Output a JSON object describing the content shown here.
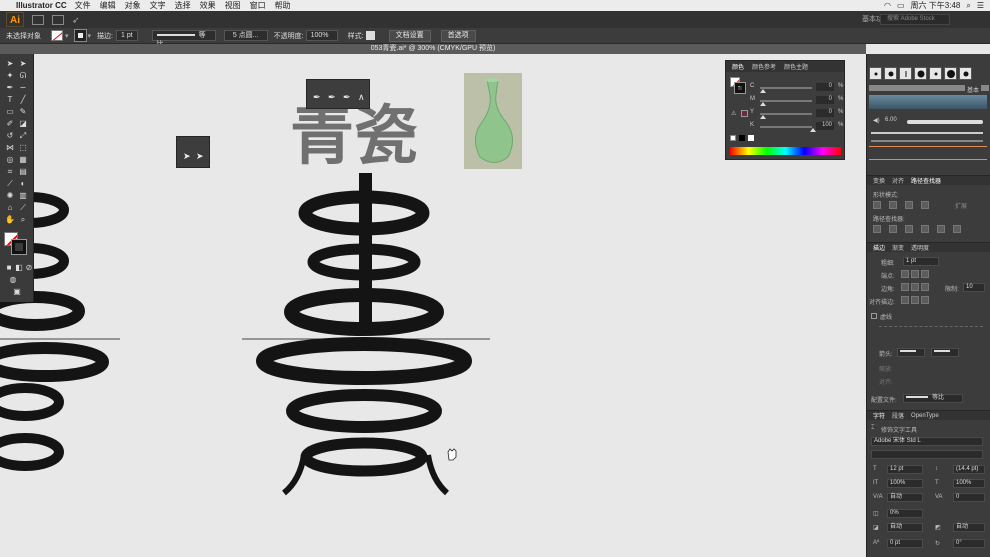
{
  "menubar": {
    "app_name": "Illustrator CC",
    "items": [
      "文件",
      "编辑",
      "对象",
      "文字",
      "选择",
      "效果",
      "视图",
      "窗口",
      "帮助"
    ],
    "clock": "周六 下午3:48"
  },
  "appbar": {
    "logo": "Ai",
    "workspace": "基本功能",
    "search_placeholder": "搜索 Adobe Stock"
  },
  "controlbar": {
    "selection_label": "未选择对象",
    "stroke_label": "描边:",
    "stroke_value": "1 pt",
    "stroke_profile": "等比",
    "brush_value": "5 点圆...",
    "opacity_label": "不透明度:",
    "opacity_value": "100%",
    "style_label": "样式:",
    "doc_setup_button": "文档设置",
    "prefs_button": "首选项"
  },
  "document": {
    "tab_title": "053青瓷.ai* @ 300% (CMYK/GPU 预览)"
  },
  "artboard": {
    "title_text": "青瓷"
  },
  "colors": {
    "art_black": "#141414",
    "title_gray": "#707070",
    "vase_green": "#8fc48c"
  },
  "color_panel": {
    "tabs": [
      "颜色",
      "颜色参考",
      "颜色主题"
    ],
    "channels": [
      {
        "label": "C",
        "value": "0",
        "unit": "%"
      },
      {
        "label": "M",
        "value": "0",
        "unit": "%"
      },
      {
        "label": "Y",
        "value": "0",
        "unit": "%"
      },
      {
        "label": "K",
        "value": "100",
        "unit": "%"
      }
    ]
  },
  "right_panel": {
    "brush_basic_label": "基本",
    "brush_size": "6.00",
    "pathfinder_tabs": [
      "变换",
      "对齐",
      "路径查找器"
    ],
    "shape_modes_label": "形状模式:",
    "expand_button": "扩展",
    "pathfinder_label": "路径查找器:",
    "stroke_tabs": [
      "描边",
      "渐变",
      "透明度"
    ],
    "weight_label": "粗细:",
    "weight_value": "1 pt",
    "cap_label": "端点:",
    "corner_label": "边角:",
    "limit_label": "限制:",
    "limit_value": "10",
    "align_stroke_label": "对齐描边:",
    "dashed_label": "虚线",
    "arrow_label": "箭头:",
    "scale_label": "缩放:",
    "align_label": "对齐:",
    "profile_label": "配置文件:",
    "profile_value": "等比",
    "char_tabs": [
      "字符",
      "段落",
      "OpenType"
    ],
    "touch_type_label": "修饰文字工具",
    "font_value": "Adobe 宋体 Std L",
    "font_size": "12 pt",
    "leading": "(14.4 pt)",
    "hscale": "100%",
    "vscale": "100%",
    "kerning": "自动",
    "tracking": "0",
    "baseline_shift": "0%",
    "auto_1": "自动",
    "auto_2": "自动",
    "rotation": "0 pt",
    "rotation2": "0°"
  }
}
